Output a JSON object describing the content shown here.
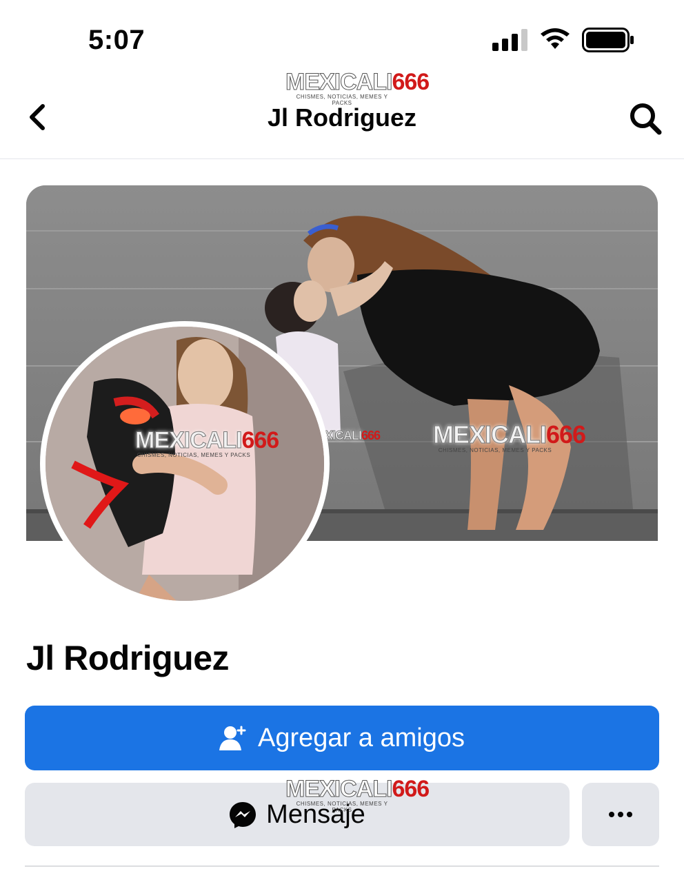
{
  "status_bar": {
    "time": "5:07"
  },
  "nav": {
    "title": "Jl Rodriguez"
  },
  "watermark": {
    "main_a": "MEXICALI",
    "main_b": "666",
    "sub": "CHISMES, NOTICIAS, MEMES Y PACKS"
  },
  "profile": {
    "name": "Jl Rodriguez"
  },
  "actions": {
    "add_friend_label": "Agregar a amigos",
    "message_label": "Mensaje",
    "more_label": "···"
  },
  "colors": {
    "primary": "#1b74e4",
    "secondary_bg": "#e4e6eb",
    "watermark_red": "#d11a1a"
  },
  "icons": {
    "back": "chevron-left-icon",
    "search": "search-icon",
    "add_friend": "person-plus-icon",
    "messenger": "messenger-icon",
    "more": "more-horizontal-icon"
  }
}
